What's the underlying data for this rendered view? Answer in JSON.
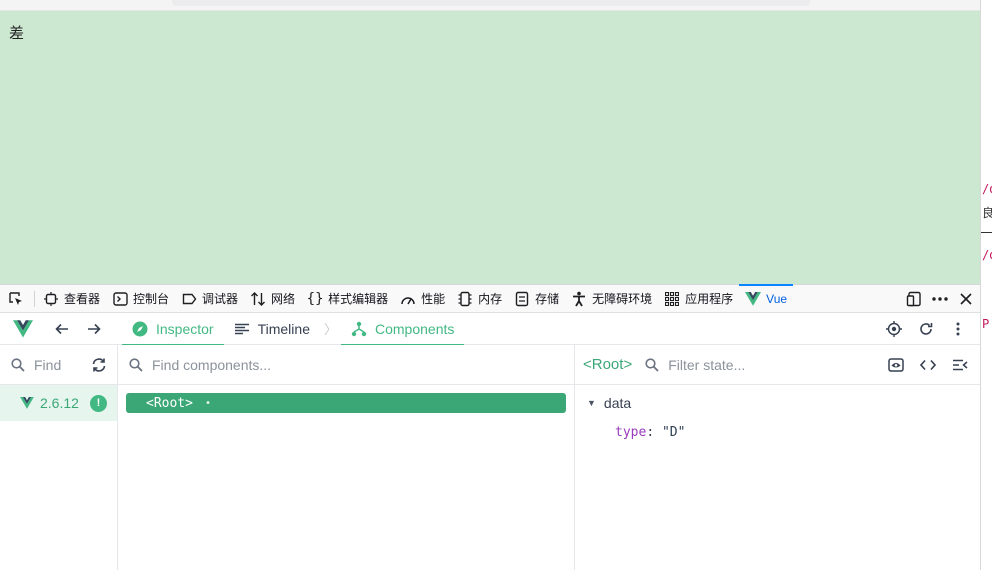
{
  "page": {
    "text": "差"
  },
  "devtools": {
    "tabs": [
      {
        "label": "查看器",
        "icon": "inspector-icon"
      },
      {
        "label": "控制台",
        "icon": "console-icon"
      },
      {
        "label": "调试器",
        "icon": "debugger-icon"
      },
      {
        "label": "网络",
        "icon": "network-icon"
      },
      {
        "label": "样式编辑器",
        "icon": "style-editor-icon"
      },
      {
        "label": "性能",
        "icon": "performance-icon"
      },
      {
        "label": "内存",
        "icon": "memory-icon"
      },
      {
        "label": "存储",
        "icon": "storage-icon"
      },
      {
        "label": "无障碍环境",
        "icon": "accessibility-icon"
      },
      {
        "label": "应用程序",
        "icon": "application-icon"
      },
      {
        "label": "Vue",
        "icon": "vue-logo-icon"
      }
    ],
    "active_tab": "Vue",
    "colors": {
      "active": "#0060df"
    }
  },
  "vue": {
    "tabs": {
      "inspector": "Inspector",
      "timeline": "Timeline",
      "components": "Components"
    },
    "apps": {
      "search_placeholder": "Find",
      "version": "2.6.12",
      "badge": "!"
    },
    "tree": {
      "search_placeholder": "Find components...",
      "root": "<Root>",
      "dot": "•"
    },
    "state": {
      "title": "<Root>",
      "search_placeholder": "Filter state...",
      "section": "data",
      "props": [
        {
          "key": "type",
          "value": "\"D\""
        }
      ]
    },
    "colors": {
      "brand": "#42b883",
      "selected": "#3ba776",
      "key": "#9b3bbd"
    }
  },
  "editor_edge": {
    "lines": [
      "/d",
      "良",
      "/d",
      "P"
    ]
  }
}
